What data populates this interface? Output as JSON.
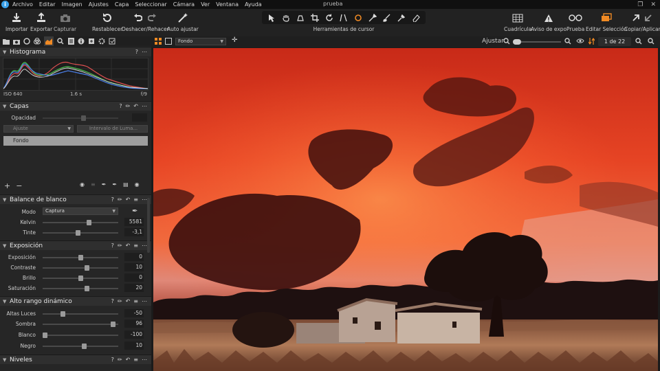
{
  "menubar": {
    "items": [
      "Archivo",
      "Editar",
      "Imagen",
      "Ajustes",
      "Capa",
      "Seleccionar",
      "Cámara",
      "Ver",
      "Ventana",
      "Ayuda"
    ],
    "window_title": "prueba"
  },
  "toolbar": {
    "import_label": "Importar",
    "export_label": "Exportar",
    "capture_label": "Capturar",
    "reset_label": "Restablecer",
    "undo_redo_label": "Deshacer/Rehacer",
    "auto_adjust_label": "Auto ajustar",
    "cursor_tools_label": "Herramientas de cursor",
    "grid_label": "Cuadrícula",
    "exposure_warning_label": "Aviso de expo",
    "proof_label": "Prueba",
    "edit_selection_label": "Editar Selección",
    "copy_apply_label": "Copiar/Aplicar"
  },
  "histogram": {
    "title": "Histograma",
    "iso": "ISO 640",
    "shutter": "1.6 s",
    "aperture": "f/9"
  },
  "layers": {
    "title": "Capas",
    "opacity_label": "Opacidad",
    "adjust_placeholder": "Ajuste",
    "luma_range_label": "Intervalo de Luma...",
    "layer_name": "Fondo"
  },
  "white_balance": {
    "title": "Balance de blanco",
    "mode_label": "Modo",
    "mode_value": "Captura",
    "kelvin_label": "Kelvin",
    "kelvin_value": "5581",
    "kelvin_level": 0.62,
    "tint_label": "Tinte",
    "tint_value": "-3,1",
    "tint_level": 0.47
  },
  "exposure": {
    "title": "Exposición",
    "rows": [
      {
        "label": "Exposición",
        "value": "0",
        "level": 0.5
      },
      {
        "label": "Contraste",
        "value": "10",
        "level": 0.59
      },
      {
        "label": "Brillo",
        "value": "0",
        "level": 0.5
      },
      {
        "label": "Saturación",
        "value": "20",
        "level": 0.59
      }
    ]
  },
  "hdr": {
    "title": "Alto rango dinámico",
    "rows": [
      {
        "label": "Altas Luces",
        "value": "-50",
        "level": 0.25
      },
      {
        "label": "Sombra",
        "value": "96",
        "level": 0.96
      },
      {
        "label": "Blanco",
        "value": "-100",
        "level": 0.0
      },
      {
        "label": "Negro",
        "value": "10",
        "level": 0.55
      }
    ]
  },
  "levels": {
    "title": "Niveles"
  },
  "viewer_bar": {
    "layer_select": "Fondo",
    "fit_label": "Ajustar",
    "page_counter": "1 de 22"
  },
  "colors": {
    "accent": "#f08a24",
    "histogram_red": "#e05050",
    "histogram_green": "#4cc04c",
    "histogram_blue": "#4a7ee8"
  }
}
